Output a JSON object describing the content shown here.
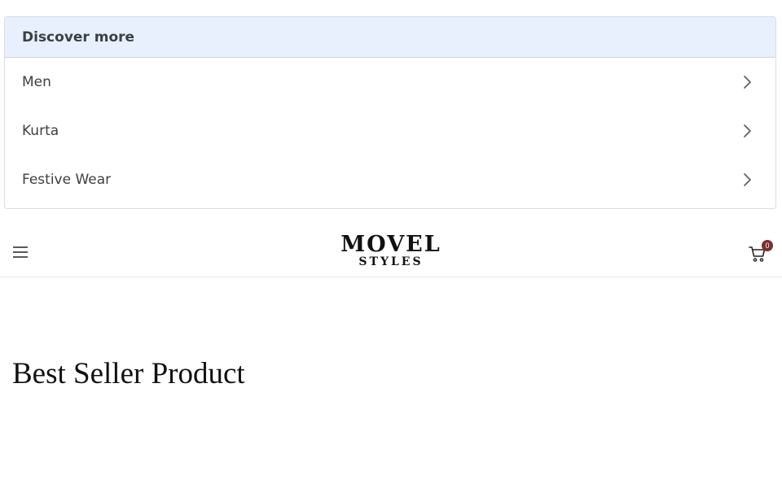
{
  "discover": {
    "title": "Discover more",
    "items": [
      {
        "label": "Men"
      },
      {
        "label": "Kurta"
      },
      {
        "label": "Festive Wear"
      }
    ]
  },
  "header": {
    "menu_icon": "hamburger-menu-icon",
    "logo": {
      "main": "MOVEL",
      "sub": "STYLES"
    },
    "cart": {
      "icon": "shopping-cart-icon",
      "count": "0",
      "badge_color": "#7a2e2e"
    }
  },
  "main": {
    "section_title": "Best Seller Product"
  },
  "colors": {
    "discover_header_bg": "#e8f0fe",
    "text": "#3c4043"
  }
}
